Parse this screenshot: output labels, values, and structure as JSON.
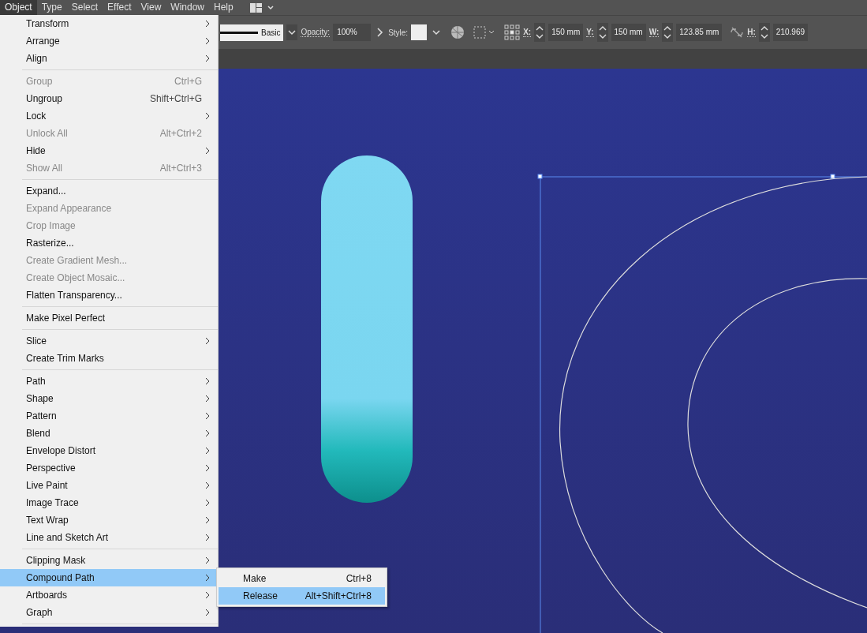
{
  "menu_bar": [
    {
      "label": "Object",
      "selected": true
    },
    {
      "label": "Type",
      "selected": false
    },
    {
      "label": "Select",
      "selected": false
    },
    {
      "label": "Effect",
      "selected": false
    },
    {
      "label": "View",
      "selected": false
    },
    {
      "label": "Window",
      "selected": false
    },
    {
      "label": "Help",
      "selected": false
    }
  ],
  "control_bar": {
    "stroke_style": "Basic",
    "opacity_label": "Opacity:",
    "opacity": "100%",
    "style_label": "Style:",
    "fields": [
      {
        "label": "X:",
        "value": "150 mm"
      },
      {
        "label": "Y:",
        "value": "150 mm"
      },
      {
        "label": "W:",
        "value": "123.85 mm"
      },
      {
        "label": "H:",
        "value": "210.969"
      }
    ]
  },
  "object_menu": [
    {
      "kind": "item",
      "label": "Transform",
      "submenu": true,
      "disabled": false,
      "selected": false
    },
    {
      "kind": "item",
      "label": "Arrange",
      "submenu": true,
      "disabled": false,
      "selected": false
    },
    {
      "kind": "item",
      "label": "Align",
      "submenu": true,
      "disabled": false,
      "selected": false
    },
    {
      "kind": "separator"
    },
    {
      "kind": "item",
      "label": "Group",
      "shortcut": "Ctrl+G",
      "disabled": true,
      "selected": false
    },
    {
      "kind": "item",
      "label": "Ungroup",
      "shortcut": "Shift+Ctrl+G",
      "disabled": false,
      "selected": false
    },
    {
      "kind": "item",
      "label": "Lock",
      "submenu": true,
      "disabled": false,
      "selected": false
    },
    {
      "kind": "item",
      "label": "Unlock All",
      "shortcut": "Alt+Ctrl+2",
      "disabled": true,
      "selected": false
    },
    {
      "kind": "item",
      "label": "Hide",
      "submenu": true,
      "disabled": false,
      "selected": false
    },
    {
      "kind": "item",
      "label": "Show All",
      "shortcut": "Alt+Ctrl+3",
      "disabled": true,
      "selected": false
    },
    {
      "kind": "separator"
    },
    {
      "kind": "item",
      "label": "Expand...",
      "disabled": false,
      "selected": false
    },
    {
      "kind": "item",
      "label": "Expand Appearance",
      "disabled": true,
      "selected": false
    },
    {
      "kind": "item",
      "label": "Crop Image",
      "disabled": true,
      "selected": false
    },
    {
      "kind": "item",
      "label": "Rasterize...",
      "disabled": false,
      "selected": false
    },
    {
      "kind": "item",
      "label": "Create Gradient Mesh...",
      "disabled": true,
      "selected": false
    },
    {
      "kind": "item",
      "label": "Create Object Mosaic...",
      "disabled": true,
      "selected": false
    },
    {
      "kind": "item",
      "label": "Flatten Transparency...",
      "disabled": false,
      "selected": false
    },
    {
      "kind": "separator"
    },
    {
      "kind": "item",
      "label": "Make Pixel Perfect",
      "disabled": false,
      "selected": false
    },
    {
      "kind": "separator"
    },
    {
      "kind": "item",
      "label": "Slice",
      "submenu": true,
      "disabled": false,
      "selected": false
    },
    {
      "kind": "item",
      "label": "Create Trim Marks",
      "disabled": false,
      "selected": false
    },
    {
      "kind": "separator"
    },
    {
      "kind": "item",
      "label": "Path",
      "submenu": true,
      "disabled": false,
      "selected": false
    },
    {
      "kind": "item",
      "label": "Shape",
      "submenu": true,
      "disabled": false,
      "selected": false
    },
    {
      "kind": "item",
      "label": "Pattern",
      "submenu": true,
      "disabled": false,
      "selected": false
    },
    {
      "kind": "item",
      "label": "Blend",
      "submenu": true,
      "disabled": false,
      "selected": false
    },
    {
      "kind": "item",
      "label": "Envelope Distort",
      "submenu": true,
      "disabled": false,
      "selected": false
    },
    {
      "kind": "item",
      "label": "Perspective",
      "submenu": true,
      "disabled": false,
      "selected": false
    },
    {
      "kind": "item",
      "label": "Live Paint",
      "submenu": true,
      "disabled": false,
      "selected": false
    },
    {
      "kind": "item",
      "label": "Image Trace",
      "submenu": true,
      "disabled": false,
      "selected": false
    },
    {
      "kind": "item",
      "label": "Text Wrap",
      "submenu": true,
      "disabled": false,
      "selected": false
    },
    {
      "kind": "item",
      "label": "Line and Sketch Art",
      "submenu": true,
      "disabled": false,
      "selected": false
    },
    {
      "kind": "separator"
    },
    {
      "kind": "item",
      "label": "Clipping Mask",
      "submenu": true,
      "disabled": false,
      "selected": false
    },
    {
      "kind": "item",
      "label": "Compound Path",
      "submenu": true,
      "disabled": false,
      "selected": true
    },
    {
      "kind": "item",
      "label": "Artboards",
      "submenu": true,
      "disabled": false,
      "selected": false
    },
    {
      "kind": "item",
      "label": "Graph",
      "submenu": true,
      "disabled": false,
      "selected": false
    },
    {
      "kind": "separator"
    }
  ],
  "compound_path_submenu": [
    {
      "label": "Make",
      "shortcut": "Ctrl+8",
      "selected": false
    },
    {
      "label": "Release",
      "shortcut": "Alt+Shift+Ctrl+8",
      "selected": true
    }
  ]
}
